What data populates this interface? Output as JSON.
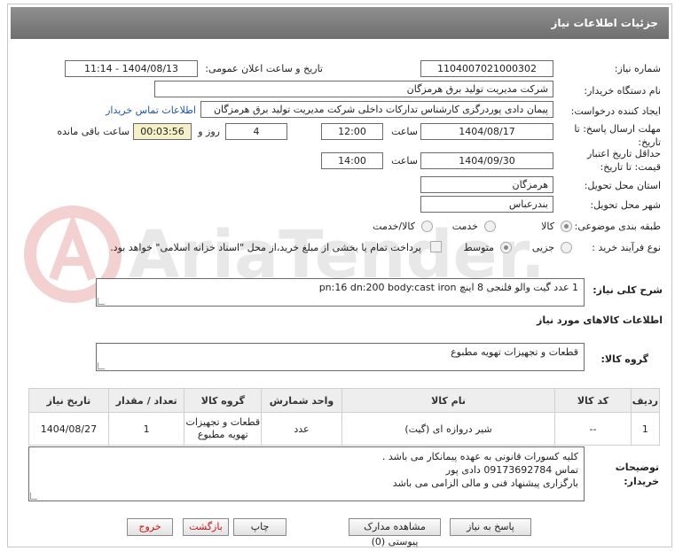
{
  "header": {
    "title": "جزئیات اطلاعات نیاز"
  },
  "watermark": "AriaTender.net",
  "form": {
    "need_number_label": "شماره نیاز:",
    "need_number": "1104007021000302",
    "announce_label": "تاریخ و ساعت اعلان عمومی:",
    "announce_value": "1404/08/13 - 11:14",
    "buyer_org_label": "نام دستگاه خریدار:",
    "buyer_org": "شرکت مدیریت تولید برق هرمزگان",
    "requester_label": "ایجاد کننده درخواست:",
    "requester": "پیمان دادی پوردرگزی کارشناس تدارکات داخلی شرکت مدیریت تولید برق هرمزگان",
    "contact_link": "اطلاعات تماس خریدار",
    "deadline_label": "مهلت ارسال پاسخ: تا تاریخ:",
    "deadline_date": "1404/08/17",
    "time_label": "ساعت",
    "deadline_time": "12:00",
    "days_value": "4",
    "days_label": "روز و",
    "remaining_value": "00:03:56",
    "remaining_label": "ساعت باقی مانده",
    "validity_label": "حداقل تاریخ اعتبار قیمت: تا تاریخ:",
    "validity_date": "1404/09/30",
    "validity_time": "14:00",
    "province_label": "استان محل تحویل:",
    "province": "هرمزگان",
    "city_label": "شهر محل تحویل:",
    "city": "بندرعباس",
    "category_label": "طبقه بندی موضوعی:",
    "category_options": [
      "کالا",
      "خدمت",
      "کالا/خدمت"
    ],
    "process_label": "نوع فرآیند خرید :",
    "process_options": [
      "جزیی",
      "متوسط"
    ],
    "treasury_text": "پرداخت تمام یا بخشی از مبلغ خرید،از محل \"اسناد خزانه اسلامی\" خواهد بود."
  },
  "description": {
    "label": "شرح کلی نیاز:",
    "text": "1 عدد گیت والو فلنجی 8 اینچ pn:16 dn:200 body:cast iron"
  },
  "goods_info_title": "اطلاعات کالاهای مورد نیاز",
  "goods_group": {
    "label": "گروه کالا:",
    "value": "قطعات و تجهیزات تهویه مطبوع"
  },
  "table": {
    "headers": [
      "ردیف",
      "کد کالا",
      "نام کالا",
      "واحد شمارش",
      "قطعات و تجهیزات",
      "تعداد / مقدار",
      "تاریخ نیاز"
    ],
    "header_goods_group": "گروه کالا",
    "rows": [
      {
        "row": "1",
        "code": "--",
        "name": "شیر دروازه ای (گیت)",
        "unit": "عدد",
        "group_line1": "قطعات و تجهیزات",
        "group_line2": "تهویه مطبوع",
        "qty": "1",
        "date": "1404/08/27"
      }
    ]
  },
  "buyer_notes": {
    "label_line1": "توضیحات",
    "label_line2": "خریدار:",
    "lines": [
      "کلیه کسورات قانونی به عهده پیمانکار می باشد   .",
      "تماس   09173692784 دادی پور",
      "بارگزاری پیشنهاد فنی و مالی الزامی می باشد"
    ]
  },
  "buttons": {
    "reply": "پاسخ به نیاز",
    "docs": "مشاهده مدارک پیوستی (0)",
    "print": "چاپ",
    "back": "بازگشت",
    "exit": "خروج"
  },
  "colors": {
    "header_bg": "#7f7f7f",
    "link": "#1a55b5",
    "remaining_bg": "#f5f0c8",
    "danger": "#cc1111"
  }
}
